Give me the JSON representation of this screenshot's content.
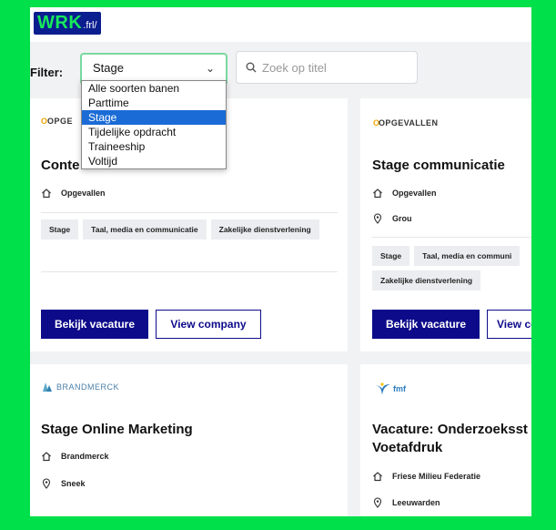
{
  "header": {
    "logo_main": "WRK",
    "logo_suffix": ".frl/"
  },
  "filter": {
    "label": "Filter:",
    "selected": "Stage",
    "options": [
      "Alle soorten banen",
      "Parttime",
      "Stage",
      "Tijdelijke opdracht",
      "Traineeship",
      "Voltijd"
    ],
    "selected_index": 2
  },
  "search": {
    "placeholder": "Zoek op titel"
  },
  "cards": [
    {
      "logo_text": "OPGE",
      "title": "Conte",
      "company": "Opgevallen",
      "tags": [
        "Stage",
        "Taal, media en communicatie",
        "Zakelijke dienstverlening"
      ],
      "view_label": "Bekijk vacature",
      "company_label": "View company"
    },
    {
      "logo_text": "OPGEVALLEN",
      "title": "Stage communicatie",
      "company": "Opgevallen",
      "location": "Grou",
      "tags": [
        "Stage",
        "Taal, media en communi",
        "Zakelijke dienstverlening"
      ],
      "view_label": "Bekijk vacature",
      "company_label": "View co"
    },
    {
      "logo_text": "BRANDMERCK",
      "title": "Stage Online Marketing",
      "company": "Brandmerck",
      "location": "Sneek"
    },
    {
      "logo_text": "fmf",
      "title": "Vacature: Onderzoeksst",
      "title_line2": "Voetafdruk",
      "company": "Friese Milieu Federatie",
      "location": "Leeuwarden"
    }
  ],
  "colors": {
    "frame_green": "#00e04a",
    "brand_navy": "#0d0b8a",
    "select_highlight": "#1a6bd6"
  }
}
